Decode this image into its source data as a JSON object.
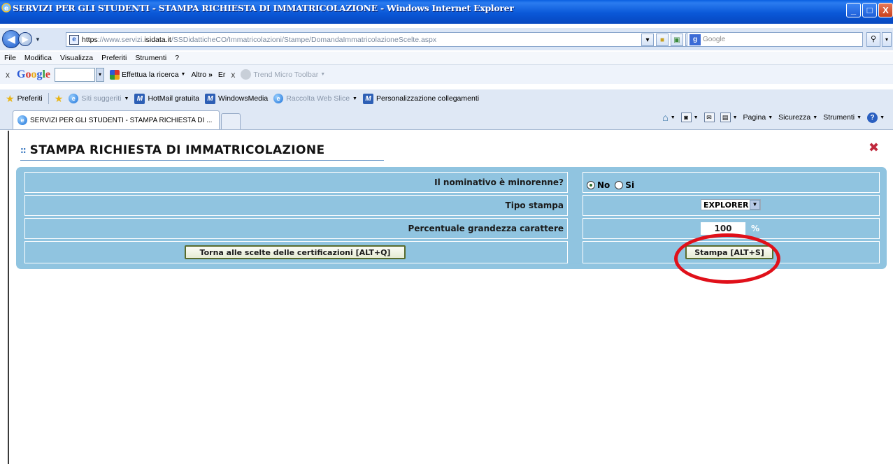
{
  "window": {
    "title": "SERVIZI PER GLI STUDENTI - STAMPA RICHIESTA DI IMMATRICOLAZIONE - Windows Internet Explorer",
    "buttons": {
      "minimize": "_",
      "maximize": "□",
      "close": "X"
    }
  },
  "address": {
    "url_scheme": "https",
    "url_prefix": "://www.servizi.",
    "url_domain": "isidata.it",
    "url_path": "/SSDidatticheCO/Immatricolazioni/Stampe/DomandaImmatricolazioneScelte.aspx",
    "search_placeholder": "Google"
  },
  "menubar": [
    "File",
    "Modifica",
    "Visualizza",
    "Preferiti",
    "Strumenti",
    "?"
  ],
  "google_toolbar": {
    "close": "x",
    "logo": [
      "G",
      "o",
      "o",
      "g",
      "l",
      "e"
    ],
    "search_action": "Effettua la ricerca",
    "more": "Altro",
    "er": "Er",
    "close2": "x",
    "trend_micro": "Trend Micro Toolbar"
  },
  "favorites": {
    "label": "Preferiti",
    "items": [
      "Siti suggeriti",
      "HotMail gratuita",
      "WindowsMedia",
      "Raccolta Web Slice",
      "Personalizzazione collegamenti"
    ]
  },
  "tab": {
    "title": "SERVIZI PER GLI STUDENTI - STAMPA RICHIESTA DI ..."
  },
  "commandbar": {
    "page": "Pagina",
    "safety": "Sicurezza",
    "tools": "Strumenti"
  },
  "page": {
    "title": "STAMPA RICHIESTA DI IMMATRICOLAZIONE",
    "form": {
      "minor_label": "Il nominativo è minorenne?",
      "minor_options": [
        {
          "label": "No",
          "selected": true
        },
        {
          "label": "Si",
          "selected": false
        }
      ],
      "print_type_label": "Tipo stampa",
      "print_type_value": "EXPLORER",
      "font_size_label": "Percentuale grandezza carattere",
      "font_size_value": "100",
      "font_size_unit": "%",
      "back_button": "Torna alle scelte delle certificazioni [ALT+Q]",
      "print_button": "Stampa [ALT+S]"
    }
  },
  "colors": {
    "panel": "#90c4e0",
    "highlight_circle": "#e0101a",
    "titlebar": "#0a58d8"
  }
}
